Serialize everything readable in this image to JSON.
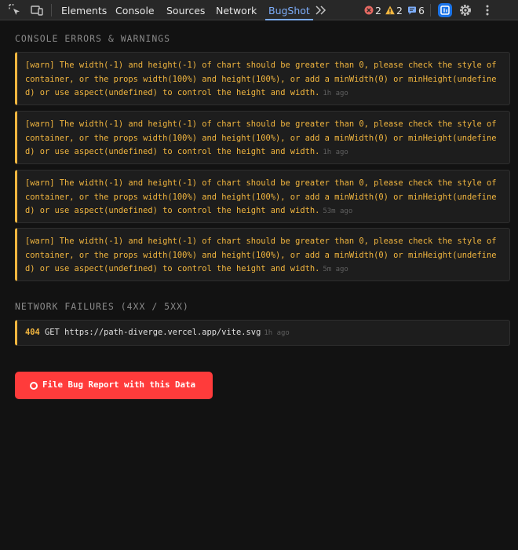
{
  "toolbar": {
    "tabs": [
      "Elements",
      "Console",
      "Sources",
      "Network",
      "BugShot"
    ],
    "active_tab": "BugShot",
    "more_glyph": "»",
    "error_count": "2",
    "warning_count": "2",
    "message_count": "6",
    "accent_color": "#7cacf8"
  },
  "console_section": {
    "title": "CONSOLE ERRORS & WARNINGS",
    "entries": [
      {
        "message": "[warn] The width(-1) and height(-1) of chart should be greater than 0, please check the style of container, or the props width(100%) and height(100%), or add a minWidth(0) or minHeight(undefined) or use aspect(undefined) to control the height and width.",
        "time": "1h ago"
      },
      {
        "message": "[warn] The width(-1) and height(-1) of chart should be greater than 0, please check the style of container, or the props width(100%) and height(100%), or add a minWidth(0) or minHeight(undefined) or use aspect(undefined) to control the height and width.",
        "time": "1h ago"
      },
      {
        "message": "[warn] The width(-1) and height(-1) of chart should be greater than 0, please check the style of container, or the props width(100%) and height(100%), or add a minWidth(0) or minHeight(undefined) or use aspect(undefined) to control the height and width.",
        "time": "53m ago"
      },
      {
        "message": "[warn] The width(-1) and height(-1) of chart should be greater than 0, please check the style of container, or the props width(100%) and height(100%), or add a minWidth(0) or minHeight(undefined) or use aspect(undefined) to control the height and width.",
        "time": "5m ago"
      }
    ]
  },
  "network_section": {
    "title": "NETWORK FAILURES (4XX / 5XX)",
    "entries": [
      {
        "status": "404",
        "method": "GET",
        "url": "https://path-diverge.vercel.app/vite.svg",
        "time": "1h ago"
      }
    ]
  },
  "bug_button": {
    "label": "File Bug Report with this Data",
    "color": "#ff3b3b"
  },
  "colors": {
    "warning": "#f2b63f",
    "error": "#f28b82",
    "background": "#121212"
  },
  "icons": [
    "inspect-icon",
    "device-toggle-icon",
    "more-tabs-icon",
    "error-icon",
    "warning-icon",
    "message-icon",
    "extension-icon",
    "settings-icon",
    "kebab-menu-icon"
  ]
}
